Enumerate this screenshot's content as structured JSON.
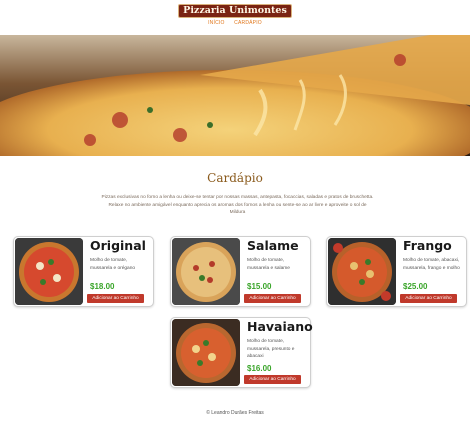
{
  "header": {
    "logo_text": "Pizzaria Unimontes",
    "nav": [
      "INÍCIO",
      "CARDÁPIO"
    ]
  },
  "menu": {
    "title": "Cardápio",
    "description": "Pizzas exclusivas no forno a lenha ou deixe-se tentar por nossas massas, antepasta, focaccias, saladas e pratos de bruschetta. Relaxe no ambiente amigável enquanto aprecia os aromas dos fornos a lenha ou sente-se ao ar livre e aproveite o sol de Mildura",
    "add_label": "Adicionar ao Carrinho",
    "items": [
      {
        "name": "Original",
        "description": "Molho de tomate, mussarela e orégano",
        "price": "$18.00"
      },
      {
        "name": "Salame",
        "description": "Molho de tomate, mussarela e salame",
        "price": "$15.00"
      },
      {
        "name": "Frango",
        "description": "Molho de tomate, abacaxi, mussarela, frango e molho",
        "price": "$25.00"
      },
      {
        "name": "Havaiano",
        "description": "Molho de tomate, mussarela, presunto e abacaxi",
        "price": "$16.00"
      }
    ]
  },
  "footer": {
    "text": "© Leandro Durães Freitas"
  },
  "colors": {
    "brand": "#7a2312",
    "nav": "#e0771c",
    "title": "#8a5a1c",
    "price": "#3aa52a",
    "button": "#c0392b"
  }
}
